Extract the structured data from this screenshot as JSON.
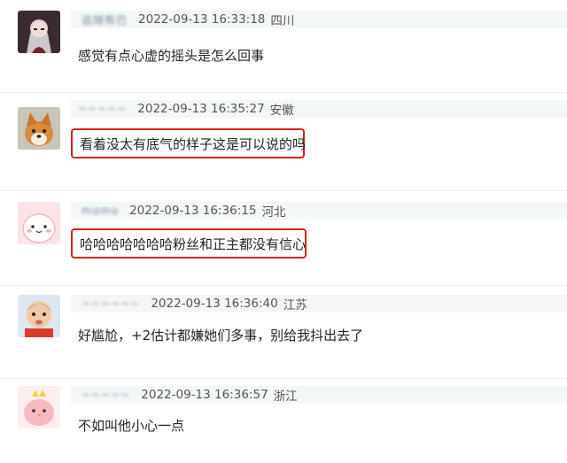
{
  "comments": [
    {
      "username": "追随熊巴",
      "timestamp": "2022-09-13 16:33:18",
      "location": "四川",
      "text": "感觉有点心虚的摇头是怎么回事",
      "avatar_icon": "anime-girl-avatar-icon",
      "highlighted": false
    },
    {
      "username": "~~~~~",
      "timestamp": "2022-09-13 16:35:27",
      "location": "安徽",
      "text": "看着没太有底气的样子这是可以说的吗",
      "avatar_icon": "shiba-dog-avatar-icon",
      "highlighted": true
    },
    {
      "username": "momo",
      "timestamp": "2022-09-13 16:36:15",
      "location": "河北",
      "text": "哈哈哈哈哈哈哈粉丝和正主都没有信心",
      "avatar_icon": "pink-blob-avatar-icon",
      "highlighted": true
    },
    {
      "username": "~~~~~~",
      "timestamp": "2022-09-13 16:36:40",
      "location": "江苏",
      "text": "好尴尬，+2估计都嫌她们多事，别给我抖出去了",
      "avatar_icon": "baby-avatar-icon",
      "highlighted": false
    },
    {
      "username": "~~~~~",
      "timestamp": "2022-09-13 16:36:57",
      "location": "浙江",
      "text": "不如叫他小心一点",
      "avatar_icon": "pink-chick-avatar-icon",
      "highlighted": false
    }
  ],
  "colors": {
    "highlight_border": "#d9221c",
    "meta_bar_bg": "#f3f7f7"
  }
}
